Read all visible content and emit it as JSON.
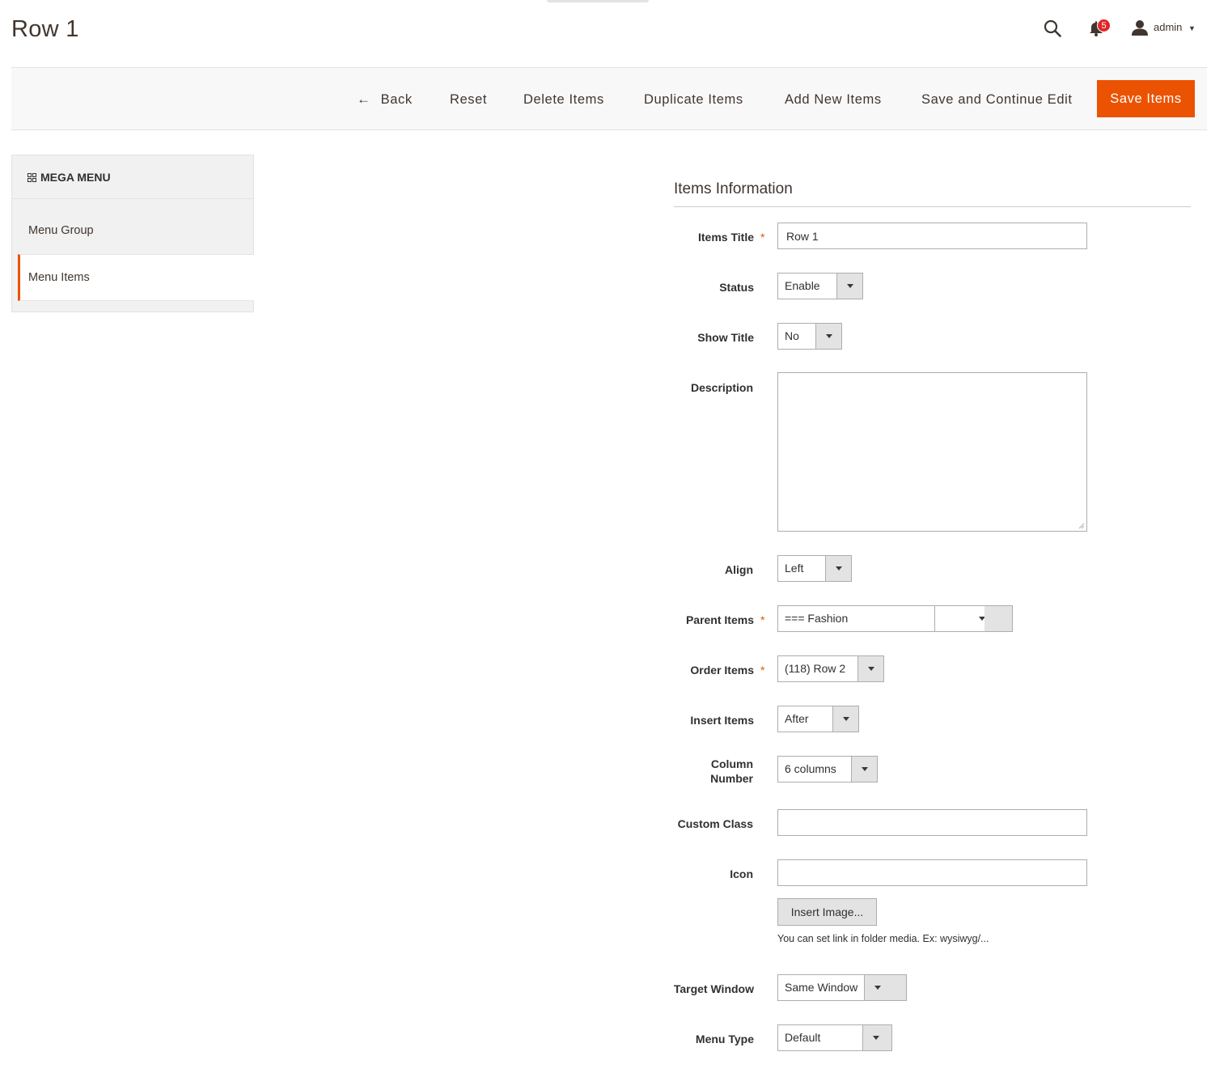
{
  "page": {
    "title": "Row 1"
  },
  "header": {
    "notifications_count": "5",
    "user_name": "admin"
  },
  "actions": {
    "back": "Back",
    "reset": "Reset",
    "delete": "Delete Items",
    "duplicate": "Duplicate Items",
    "add_new": "Add New Items",
    "save_continue": "Save and Continue Edit",
    "save": "Save Items"
  },
  "sidebar": {
    "title": "MEGA MENU",
    "items": [
      {
        "label": "Menu Group",
        "active": false
      },
      {
        "label": "Menu Items",
        "active": true
      }
    ]
  },
  "form": {
    "section_title": "Items Information",
    "required_mark": "*",
    "fields": {
      "items_title": {
        "label": "Items Title",
        "value": "Row 1"
      },
      "status": {
        "label": "Status",
        "value": "Enable"
      },
      "show_title": {
        "label": "Show Title",
        "value": "No"
      },
      "description": {
        "label": "Description",
        "value": ""
      },
      "align": {
        "label": "Align",
        "value": "Left"
      },
      "parent_items": {
        "label": "Parent Items",
        "value": "=== Fashion"
      },
      "order_items": {
        "label": "Order Items",
        "value": "(118) Row 2"
      },
      "insert_items": {
        "label": "Insert Items",
        "value": "After"
      },
      "column_number": {
        "label_line1": "Column",
        "label_line2": "Number",
        "value": "6 columns"
      },
      "custom_class": {
        "label": "Custom Class",
        "value": ""
      },
      "icon": {
        "label": "Icon",
        "value": "",
        "button": "Insert Image...",
        "note": "You can set link in folder media. Ex: wysiwyg/..."
      },
      "target_window": {
        "label": "Target Window",
        "value": "Same Window"
      },
      "menu_type": {
        "label": "Menu Type",
        "value": "Default"
      }
    }
  },
  "colors": {
    "accent": "#eb5202",
    "badge": "#e22626",
    "text": "#303030"
  }
}
